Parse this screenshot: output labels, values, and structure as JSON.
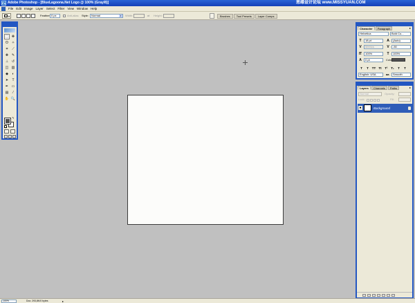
{
  "window": {
    "title": "Adobe Photoshop - [BlueLagoona.Net Logo @ 100% (Gray/8)]",
    "watermark": "思缘设计论坛 www.MISSYUAN.COM",
    "app_icon": "Ps"
  },
  "menu": {
    "items": [
      "File",
      "Edit",
      "Image",
      "Layer",
      "Select",
      "Filter",
      "View",
      "Window",
      "Help"
    ]
  },
  "options": {
    "feather_label": "Feather:",
    "feather_value": "0 px",
    "antialias_label": "Anti-alias",
    "style_label": "Style:",
    "style_value": "Normal",
    "width_label": "Width:",
    "height_label": "Height:",
    "well_tabs": [
      "Brushes",
      "Tool Presets",
      "Layer Comps"
    ]
  },
  "toolbox": {
    "tools": [
      {
        "name": "marquee",
        "glyph": "⬚"
      },
      {
        "name": "move",
        "glyph": "✥"
      },
      {
        "name": "lasso",
        "glyph": "ʘ"
      },
      {
        "name": "magic-wand",
        "glyph": "✧"
      },
      {
        "name": "crop",
        "glyph": "⌗"
      },
      {
        "name": "slice",
        "glyph": "⟋"
      },
      {
        "name": "healing-brush",
        "glyph": "✚"
      },
      {
        "name": "brush",
        "glyph": "✎"
      },
      {
        "name": "clone-stamp",
        "glyph": "⊥"
      },
      {
        "name": "history-brush",
        "glyph": "↺"
      },
      {
        "name": "eraser",
        "glyph": "◫"
      },
      {
        "name": "gradient",
        "glyph": "▥"
      },
      {
        "name": "blur",
        "glyph": "◆"
      },
      {
        "name": "dodge",
        "glyph": "◐"
      },
      {
        "name": "path-selection",
        "glyph": "➤"
      },
      {
        "name": "type",
        "glyph": "T"
      },
      {
        "name": "pen",
        "glyph": "✒"
      },
      {
        "name": "shape",
        "glyph": "▭"
      },
      {
        "name": "notes",
        "glyph": "▤"
      },
      {
        "name": "eyedropper",
        "glyph": "⁄"
      },
      {
        "name": "hand",
        "glyph": "✋"
      },
      {
        "name": "zoom",
        "glyph": "🔍"
      }
    ],
    "colors": {
      "foreground": "#505050",
      "background": "#ffffff"
    }
  },
  "character": {
    "tabs": [
      "Character",
      "Paragraph"
    ],
    "font_family": "Helvetica",
    "font_style": "Bold Co...",
    "font_size": "18 pt",
    "leading": "(Auto)",
    "kerning": "Metrics",
    "tracking": "-50",
    "vertical_scale": "100%",
    "horizontal_scale": "100%",
    "baseline_shift": "0 pt",
    "color_label": "Color:",
    "color_value": "#505050",
    "language": "English: USA",
    "antialias": "aa",
    "antialias_mode": "Smooth",
    "style_buttons": [
      "T",
      "T",
      "TT",
      "Tt",
      "T¹",
      "T₁",
      "T",
      "T"
    ]
  },
  "layers": {
    "tabs": [
      "Layers",
      "Channels",
      "Paths"
    ],
    "blend_mode": "Normal",
    "opacity_label": "Opacity:",
    "lock_label": "Lock:",
    "fill_label": "Fill:",
    "layer_name": "Background"
  },
  "status": {
    "zoom": "100%",
    "doc_info": "Doc: 293,8K/0 bytes"
  }
}
